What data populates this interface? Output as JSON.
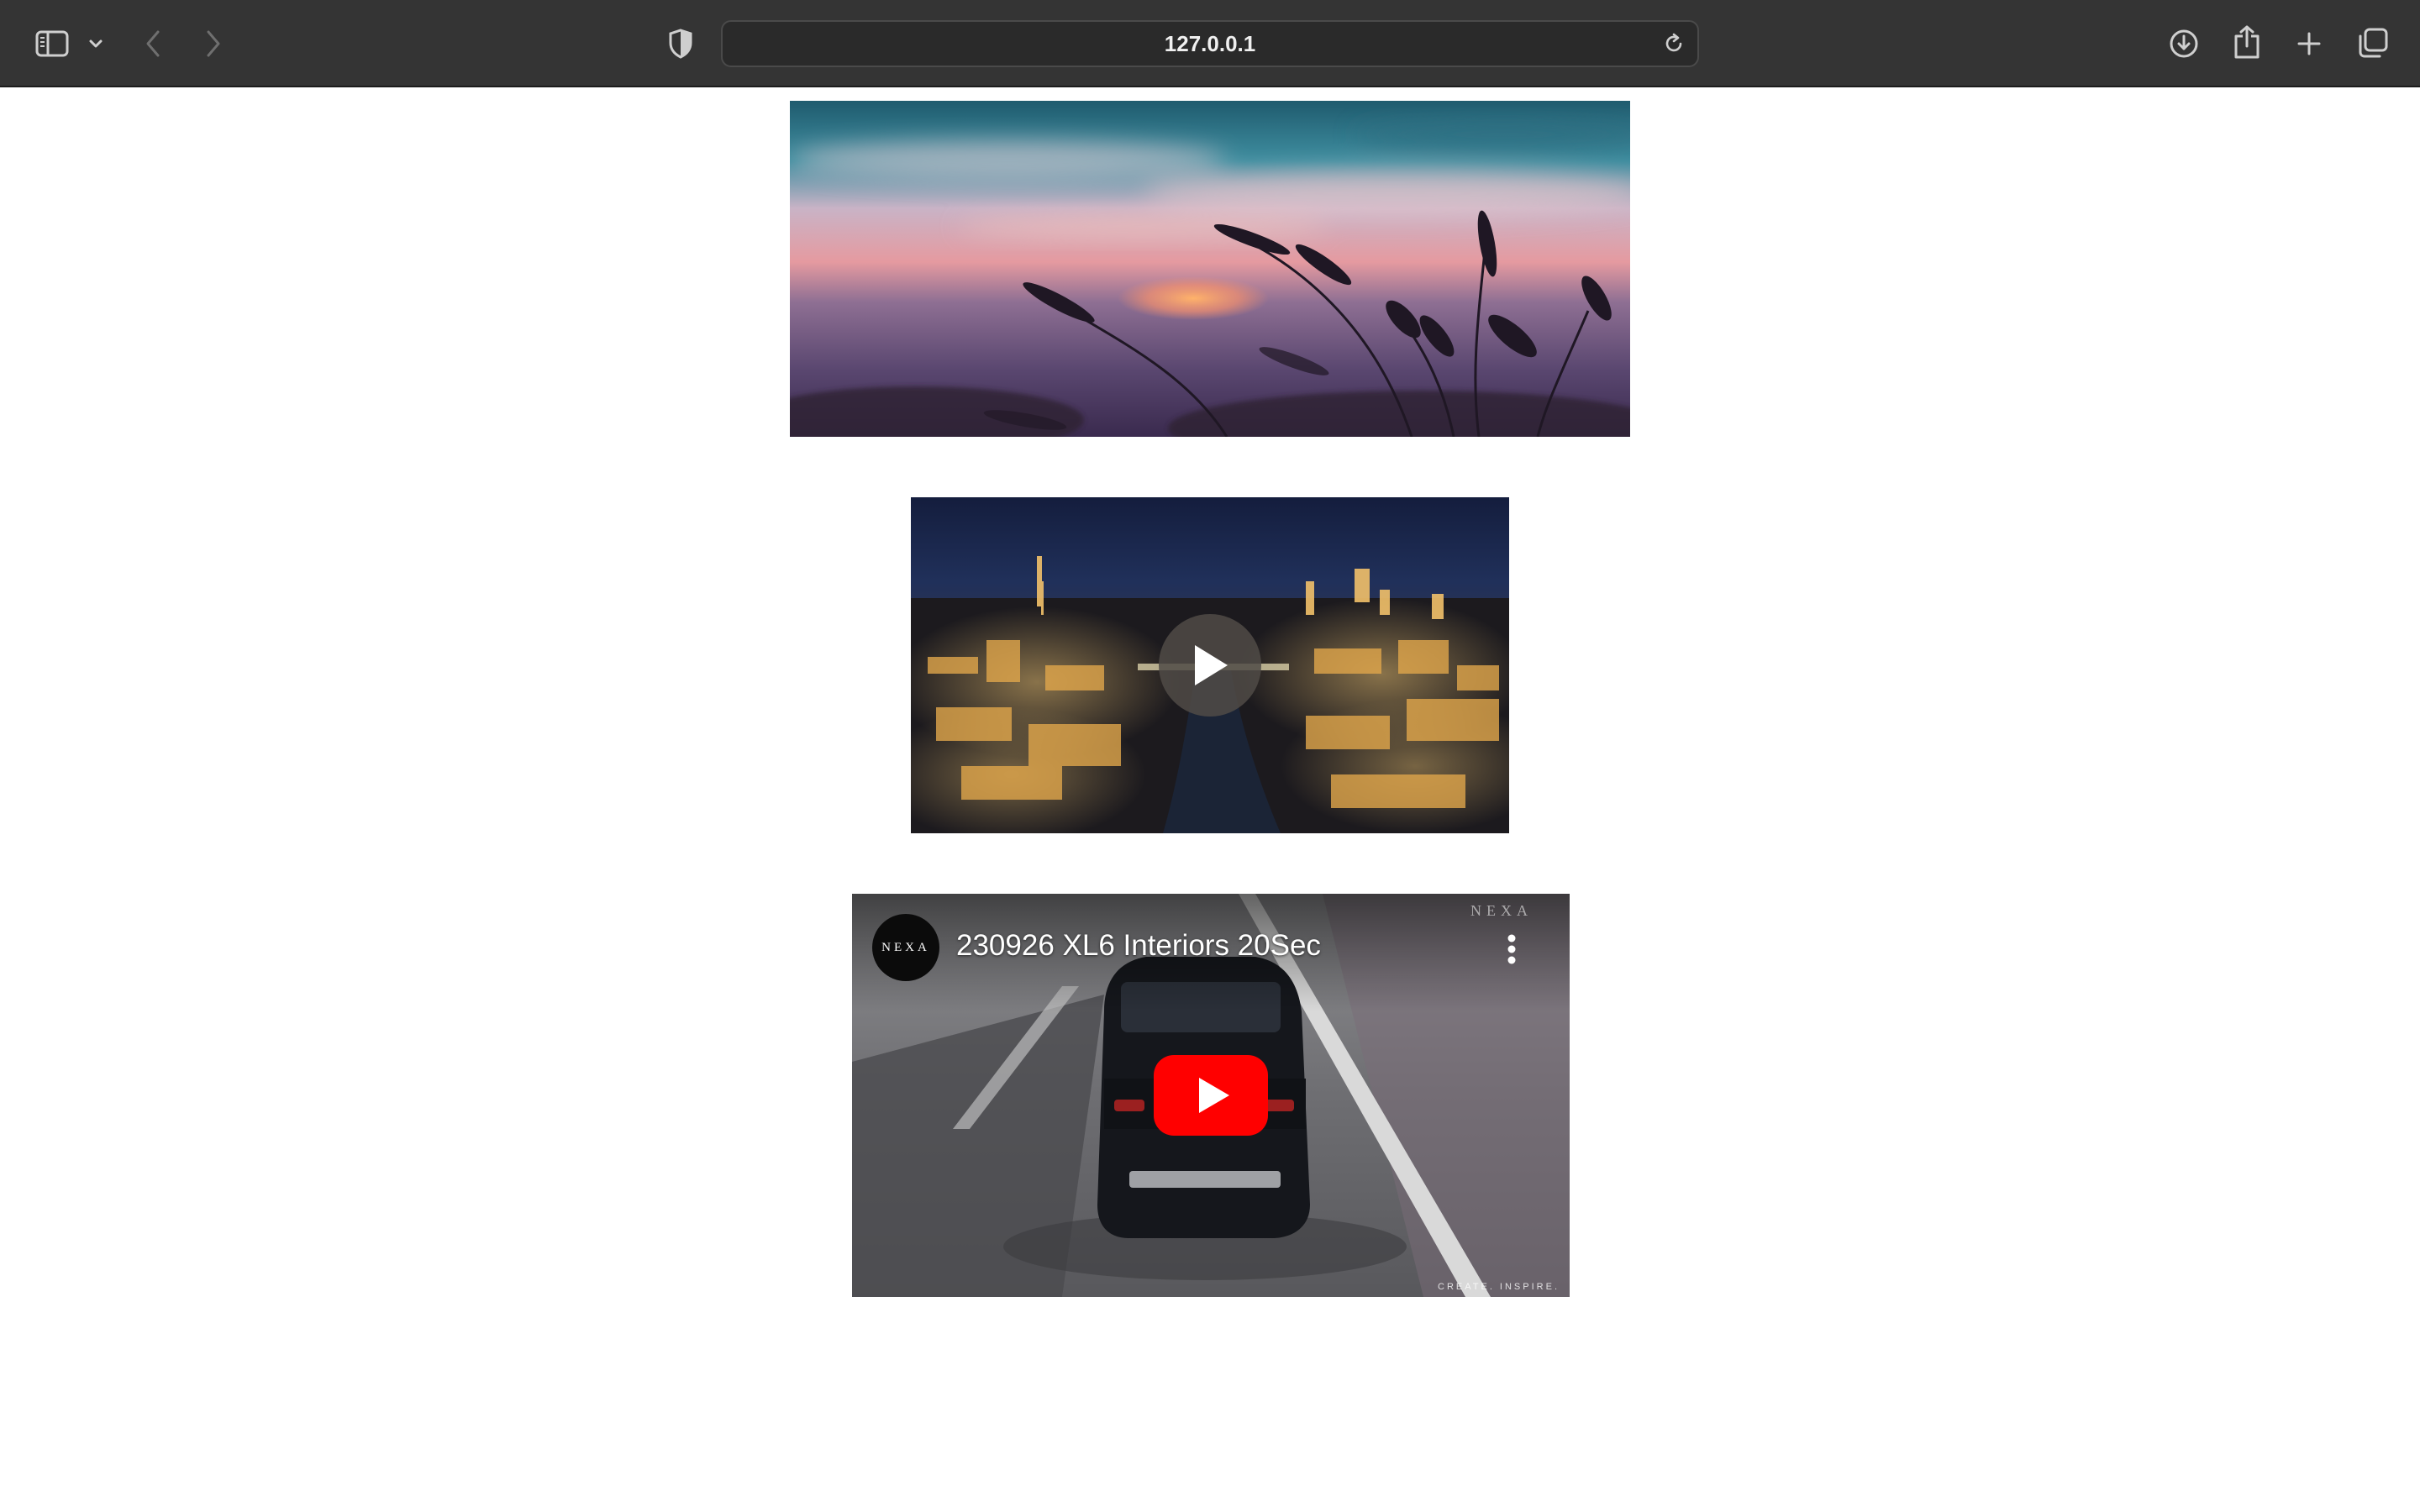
{
  "browser": {
    "url": "127.0.0.1",
    "icons": [
      "sidebar-icon",
      "chevron-down-icon",
      "back-icon",
      "forward-icon",
      "shield-icon",
      "reload-icon",
      "download-icon",
      "share-icon",
      "new-tab-icon",
      "tabs-overview-icon"
    ]
  },
  "content": {
    "image1": {
      "subject": "sunset-lavender-photo"
    },
    "video1": {
      "subject": "city-night-aerial-video",
      "play_icon": "play-icon"
    },
    "video2": {
      "title": "230926 XL6 Interiors 20Sec",
      "channel_logo": "NEXA",
      "brand_watermark": "NEXA",
      "tagline": "CREATE. INSPIRE.",
      "colors": {
        "play_button": "#ff0000"
      }
    }
  }
}
